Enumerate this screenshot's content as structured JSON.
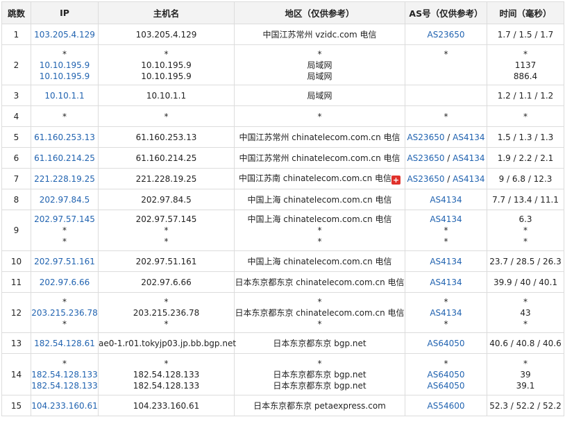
{
  "headers": [
    "跳数",
    "IP",
    "主机名",
    "地区（仅供参考）",
    "AS号（仅供参考）",
    "时间（毫秒）"
  ],
  "rows": [
    {
      "hop": "1",
      "ip": [
        "103.205.4.129"
      ],
      "host": [
        "103.205.4.129"
      ],
      "region": [
        "中国江苏常州 vzidc.com 电信"
      ],
      "as": [
        [
          "AS23650"
        ]
      ],
      "time": [
        "1.7 / 1.5 / 1.7"
      ]
    },
    {
      "hop": "2",
      "ip": [
        "*",
        "10.10.195.9",
        "10.10.195.9"
      ],
      "host": [
        "*",
        "10.10.195.9",
        "10.10.195.9"
      ],
      "region": [
        "*",
        "局域网",
        "局域网"
      ],
      "as": [
        [
          "*"
        ],
        [],
        []
      ],
      "time": [
        "*",
        "1137",
        "886.4"
      ]
    },
    {
      "hop": "3",
      "ip": [
        "10.10.1.1"
      ],
      "host": [
        "10.10.1.1"
      ],
      "region": [
        "局域网"
      ],
      "as": [
        []
      ],
      "time": [
        "1.2 / 1.1 / 1.2"
      ]
    },
    {
      "hop": "4",
      "ip": [
        "*"
      ],
      "host": [
        "*"
      ],
      "region": [
        "*"
      ],
      "as": [
        [
          "*"
        ]
      ],
      "time": [
        "*"
      ]
    },
    {
      "hop": "5",
      "ip": [
        "61.160.253.13"
      ],
      "host": [
        "61.160.253.13"
      ],
      "region": [
        "中国江苏常州 chinatelecom.com.cn 电信"
      ],
      "as": [
        [
          "AS23650",
          "AS4134"
        ]
      ],
      "time": [
        "1.5 / 1.3 / 1.3"
      ]
    },
    {
      "hop": "6",
      "ip": [
        "61.160.214.25"
      ],
      "host": [
        "61.160.214.25"
      ],
      "region": [
        "中国江苏常州 chinatelecom.com.cn 电信"
      ],
      "as": [
        [
          "AS23650",
          "AS4134"
        ]
      ],
      "time": [
        "1.9 / 2.2 / 2.1"
      ]
    },
    {
      "hop": "7",
      "ip": [
        "221.228.19.25"
      ],
      "host": [
        "221.228.19.25"
      ],
      "region": [
        "中国江苏南 chinatelecom.com.cn 电信"
      ],
      "as": [
        [
          "AS23650",
          "AS4134"
        ]
      ],
      "time": [
        "9 / 6.8 / 12.3"
      ],
      "flag": "+"
    },
    {
      "hop": "8",
      "ip": [
        "202.97.84.5"
      ],
      "host": [
        "202.97.84.5"
      ],
      "region": [
        "中国上海 chinatelecom.com.cn 电信"
      ],
      "as": [
        [
          "AS4134"
        ]
      ],
      "time": [
        "7.7 / 13.4 / 11.1"
      ]
    },
    {
      "hop": "9",
      "ip": [
        "202.97.57.145",
        "*",
        "*"
      ],
      "host": [
        "202.97.57.145",
        "*",
        "*"
      ],
      "region": [
        "中国上海 chinatelecom.com.cn 电信",
        "*",
        "*"
      ],
      "as": [
        [
          "AS4134"
        ],
        [
          "*"
        ],
        [
          "*"
        ]
      ],
      "time": [
        "6.3",
        "*",
        "*"
      ]
    },
    {
      "hop": "10",
      "ip": [
        "202.97.51.161"
      ],
      "host": [
        "202.97.51.161"
      ],
      "region": [
        "中国上海 chinatelecom.com.cn 电信"
      ],
      "as": [
        [
          "AS4134"
        ]
      ],
      "time": [
        "23.7 / 28.5 / 26.3"
      ]
    },
    {
      "hop": "11",
      "ip": [
        "202.97.6.66"
      ],
      "host": [
        "202.97.6.66"
      ],
      "region": [
        "日本东京都东京 chinatelecom.com.cn 电信"
      ],
      "as": [
        [
          "AS4134"
        ]
      ],
      "time": [
        "39.9 / 40 / 40.1"
      ]
    },
    {
      "hop": "12",
      "ip": [
        "*",
        "203.215.236.78",
        "*"
      ],
      "host": [
        "*",
        "203.215.236.78",
        "*"
      ],
      "region": [
        "*",
        "日本东京都东京 chinatelecom.com.cn 电信",
        "*"
      ],
      "as": [
        [
          "*"
        ],
        [
          "AS4134"
        ],
        [
          "*"
        ]
      ],
      "time": [
        "*",
        "43",
        "*"
      ]
    },
    {
      "hop": "13",
      "ip": [
        "182.54.128.61"
      ],
      "host": [
        "ae0-1.r01.tokyjp03.jp.bb.bgp.net"
      ],
      "region": [
        "日本东京都东京 bgp.net"
      ],
      "as": [
        [
          "AS64050"
        ]
      ],
      "time": [
        "40.6 / 40.8 / 40.6"
      ]
    },
    {
      "hop": "14",
      "ip": [
        "*",
        "182.54.128.133",
        "182.54.128.133"
      ],
      "host": [
        "*",
        "182.54.128.133",
        "182.54.128.133"
      ],
      "region": [
        "*",
        "日本东京都东京 bgp.net",
        "日本东京都东京 bgp.net"
      ],
      "as": [
        [
          "*"
        ],
        [
          "AS64050"
        ],
        [
          "AS64050"
        ]
      ],
      "time": [
        "*",
        "39",
        "39.1"
      ]
    },
    {
      "hop": "15",
      "ip": [
        "104.233.160.61"
      ],
      "host": [
        "104.233.160.61"
      ],
      "region": [
        "日本东京都东京 petaexpress.com"
      ],
      "as": [
        [
          "AS54600"
        ]
      ],
      "time": [
        "52.3 / 52.2 / 52.2"
      ]
    }
  ]
}
